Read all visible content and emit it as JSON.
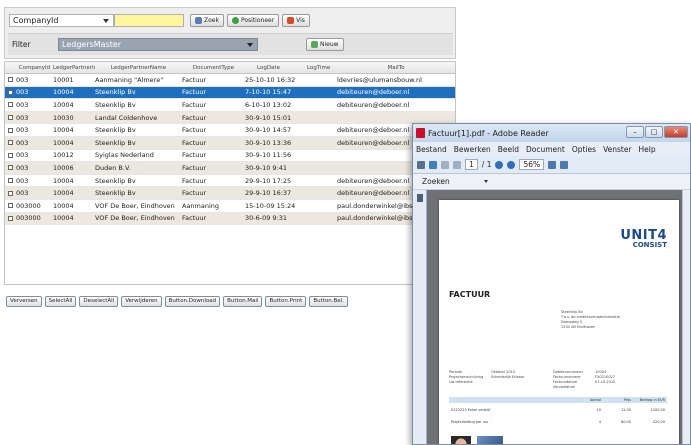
{
  "filter_panel": {
    "field_select": "CompanyId",
    "search_value": "",
    "buttons": {
      "zoek": "Zoek",
      "positioneer": "Positioneer",
      "vis": "Vis"
    },
    "filter_label": "Filter",
    "filter_select": "LedgersMaster",
    "nieuw_button": "Nieuw"
  },
  "grid": {
    "columns": [
      "CompanyId",
      "LedgerPartnerId",
      "LedgerPartnerName",
      "DocumentType",
      "LogDate",
      "LogTime",
      "MailTo"
    ],
    "rows": [
      {
        "company": "003",
        "partner_id": "10001",
        "partner_name": "Aanmaning \"Almere\"",
        "doc_type": "Factuur",
        "log_date": "25-10-10 16:32",
        "mail_to": "ldevries@ulumansbouw.nl"
      },
      {
        "company": "003",
        "partner_id": "10004",
        "partner_name": "Steenklip Bv",
        "doc_type": "Factuur",
        "log_date": "7-10-10 15:47",
        "mail_to": "debiteuren@deboer.nl"
      },
      {
        "company": "003",
        "partner_id": "10004",
        "partner_name": "Steenklip Bv",
        "doc_type": "Factuur",
        "log_date": "6-10-10 13:02",
        "mail_to": "debiteuren@deboer.nl"
      },
      {
        "company": "003",
        "partner_id": "10030",
        "partner_name": "Landal Coldenhove",
        "doc_type": "Factuur",
        "log_date": "30-9-10 15:01",
        "mail_to": ""
      },
      {
        "company": "003",
        "partner_id": "10004",
        "partner_name": "Steenklip Bv",
        "doc_type": "Factuur",
        "log_date": "30-9-10 14:57",
        "mail_to": "debiteuren@deboer.nl"
      },
      {
        "company": "003",
        "partner_id": "10004",
        "partner_name": "Steenklip Bv",
        "doc_type": "Factuur",
        "log_date": "30-9-10 13:36",
        "mail_to": "debiteuren@deboer.nl"
      },
      {
        "company": "003",
        "partner_id": "10012",
        "partner_name": "Syiglas Nederland",
        "doc_type": "Factuur",
        "log_date": "30-9-10 11:56",
        "mail_to": ""
      },
      {
        "company": "003",
        "partner_id": "10006",
        "partner_name": "Duden B.V.",
        "doc_type": "Factuur",
        "log_date": "30-9-10 9:41",
        "mail_to": ""
      },
      {
        "company": "003",
        "partner_id": "10004",
        "partner_name": "Steenklip Bv",
        "doc_type": "Factuur",
        "log_date": "29-9-10 17:25",
        "mail_to": "debiteuren@deboer.nl"
      },
      {
        "company": "003",
        "partner_id": "10004",
        "partner_name": "Steenklip Bv",
        "doc_type": "Factuur",
        "log_date": "29-9-10 16:37",
        "mail_to": "debiteuren@deboer.nl"
      },
      {
        "company": "003000",
        "partner_id": "10004",
        "partner_name": "VOF De Boer, Eindhoven",
        "doc_type": "Aanmaning",
        "log_date": "15-10-09 15:24",
        "mail_to": "paul.donderwinkel@ibs.nl"
      },
      {
        "company": "003000",
        "partner_id": "10004",
        "partner_name": "VOF De Boer, Eindhoven",
        "doc_type": "Factuur",
        "log_date": "30-6-09 9:31",
        "mail_to": "paul.donderwinkel@ibs.nl"
      }
    ]
  },
  "bottom_buttons": [
    "Verversen",
    "SelectAll",
    "DeselectAll",
    "Verwijderen",
    "Button.Download",
    "Button.Mail",
    "Button.Print",
    "Button.Bel."
  ],
  "reader": {
    "title": "Factuur[1].pdf - Adobe Reader",
    "menu": [
      "Bestand",
      "Bewerken",
      "Beeld",
      "Document",
      "Opties",
      "Venster",
      "Help"
    ],
    "page_current": "1",
    "page_total": "/ 1",
    "zoom": "56%",
    "search_label": "Zoeken",
    "logo_line1": "UNIT4",
    "logo_line2": "CONSIST",
    "invoice_title": "FACTUUR",
    "address_lines": [
      "Steenklip Bv",
      "T.a.v. de crediteurenadministratie",
      "Dorpsweg 3",
      "1234 AB Eindhoven"
    ],
    "meta_left": [
      "Periode",
      "Projectomschrijving",
      "Uw referentie"
    ],
    "meta_mid": [
      "Oktober 2010",
      "Scheidsdijk Ertsaer",
      ""
    ],
    "meta_right": [
      "Debiteurnummer",
      "Factuurnummer",
      "Factuurdatum",
      "Vervaldatum"
    ],
    "meta_right_vals": [
      "10004",
      "FX0210027",
      "07-10-2010",
      ""
    ],
    "table_head": [
      "",
      "Aantal",
      "Prijs",
      "Bedrag in EUR"
    ],
    "table_rows": [
      [
        "0123223 Enkel verblijf",
        "10",
        "12,00",
        "1200,00"
      ],
      [
        "Projectleiding per uur",
        "4",
        "80,00",
        "320,00"
      ]
    ]
  }
}
